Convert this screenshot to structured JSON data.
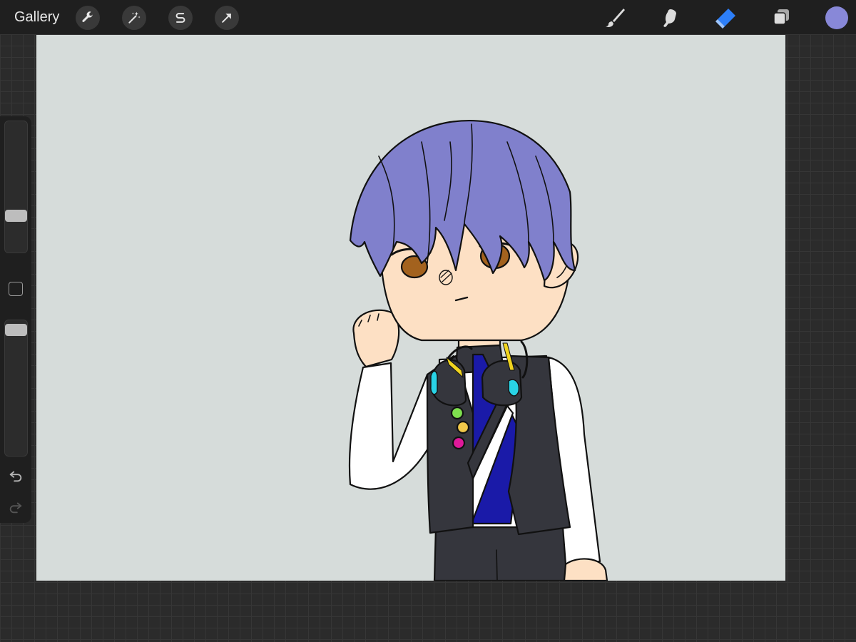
{
  "topbar": {
    "gallery_label": "Gallery",
    "left_tools": [
      {
        "name": "actions",
        "icon": "wrench-icon"
      },
      {
        "name": "adjustments",
        "icon": "magic-wand-icon"
      },
      {
        "name": "selection",
        "icon": "selection-s-icon"
      },
      {
        "name": "transform",
        "icon": "arrow-cursor-icon"
      }
    ],
    "right_tools": [
      {
        "name": "brush",
        "icon": "brush-icon",
        "active": false
      },
      {
        "name": "smudge",
        "icon": "smudge-icon",
        "active": false
      },
      {
        "name": "eraser",
        "icon": "eraser-icon",
        "active": true
      },
      {
        "name": "layers",
        "icon": "layers-icon",
        "active": false
      }
    ],
    "current_color": "#8888d8"
  },
  "sidebar": {
    "brush_size_level": 0.74,
    "opacity_level": 0.03,
    "modify_icon": "square-icon",
    "undo_icon": "undo-icon",
    "redo_icon": "redo-icon"
  },
  "colors": {
    "accent": "#2d7ff9",
    "canvas_bg": "#d6dcda",
    "hair": "#8080cc",
    "skin": "#fde0c4",
    "eyes": "#a3621e",
    "shirt": "#ffffff",
    "vest": "#35363d",
    "tie": "#1a1aa8",
    "headphone_accent": "#29d3e6",
    "headphone_stripe": "#f0d41f"
  }
}
